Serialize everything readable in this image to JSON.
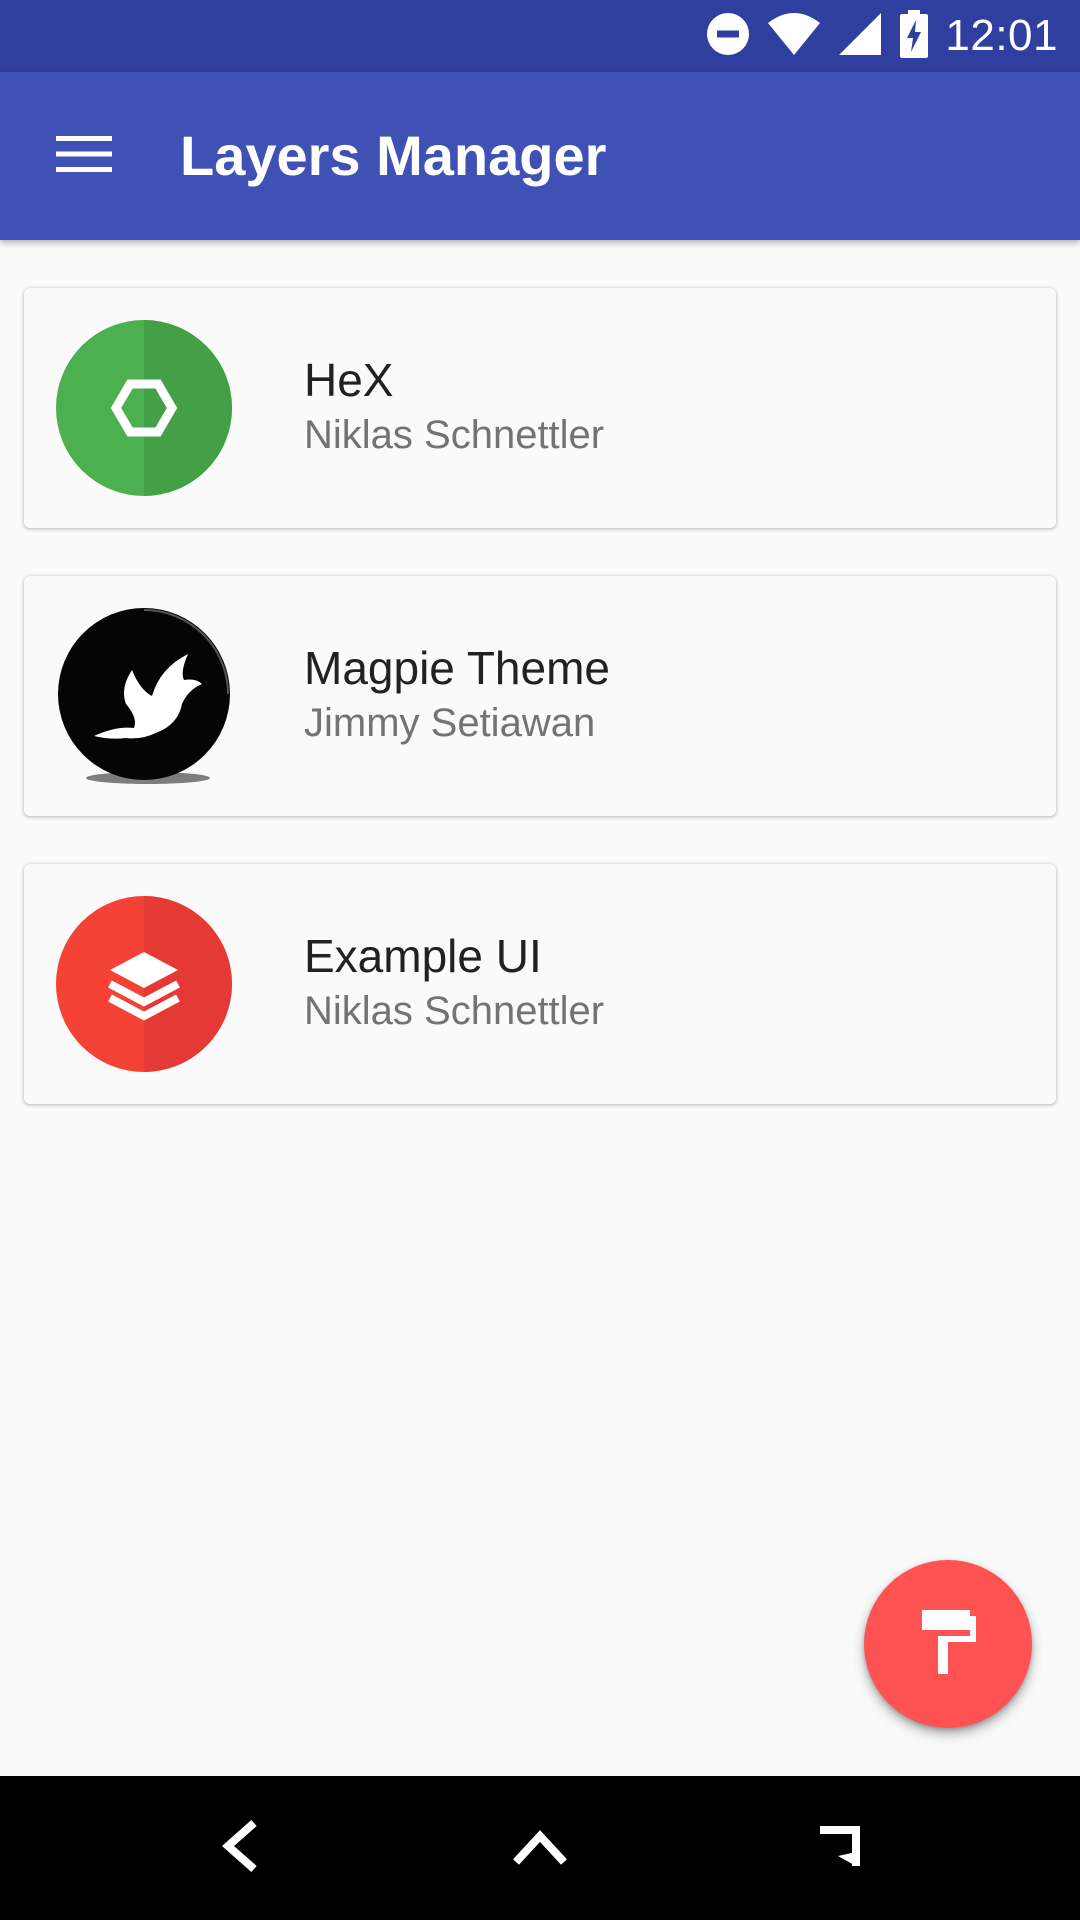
{
  "status_bar": {
    "time": "12:01",
    "icons": [
      "do-not-disturb-icon",
      "wifi-icon",
      "cell-signal-icon",
      "battery-charging-icon"
    ]
  },
  "app_bar": {
    "title": "Layers Manager",
    "menu_icon": "menu-icon"
  },
  "themes": [
    {
      "title": "HeX",
      "author": "Niklas Schnettler",
      "icon": "hexagon-icon",
      "icon_color": "#4caf50"
    },
    {
      "title": "Magpie Theme",
      "author": "Jimmy Setiawan",
      "icon": "bird-icon",
      "icon_color": "#000000"
    },
    {
      "title": "Example UI",
      "author": "Niklas Schnettler",
      "icon": "layers-icon",
      "icon_color": "#f44336"
    }
  ],
  "fab": {
    "icon": "paint-roller-icon",
    "color": "#ff5252"
  },
  "nav_bar": {
    "icons": [
      "back-icon",
      "home-icon",
      "recents-icon"
    ]
  },
  "colors": {
    "primary": "#3f51b5",
    "primary_dark": "#303f9f",
    "accent": "#ff5252"
  }
}
